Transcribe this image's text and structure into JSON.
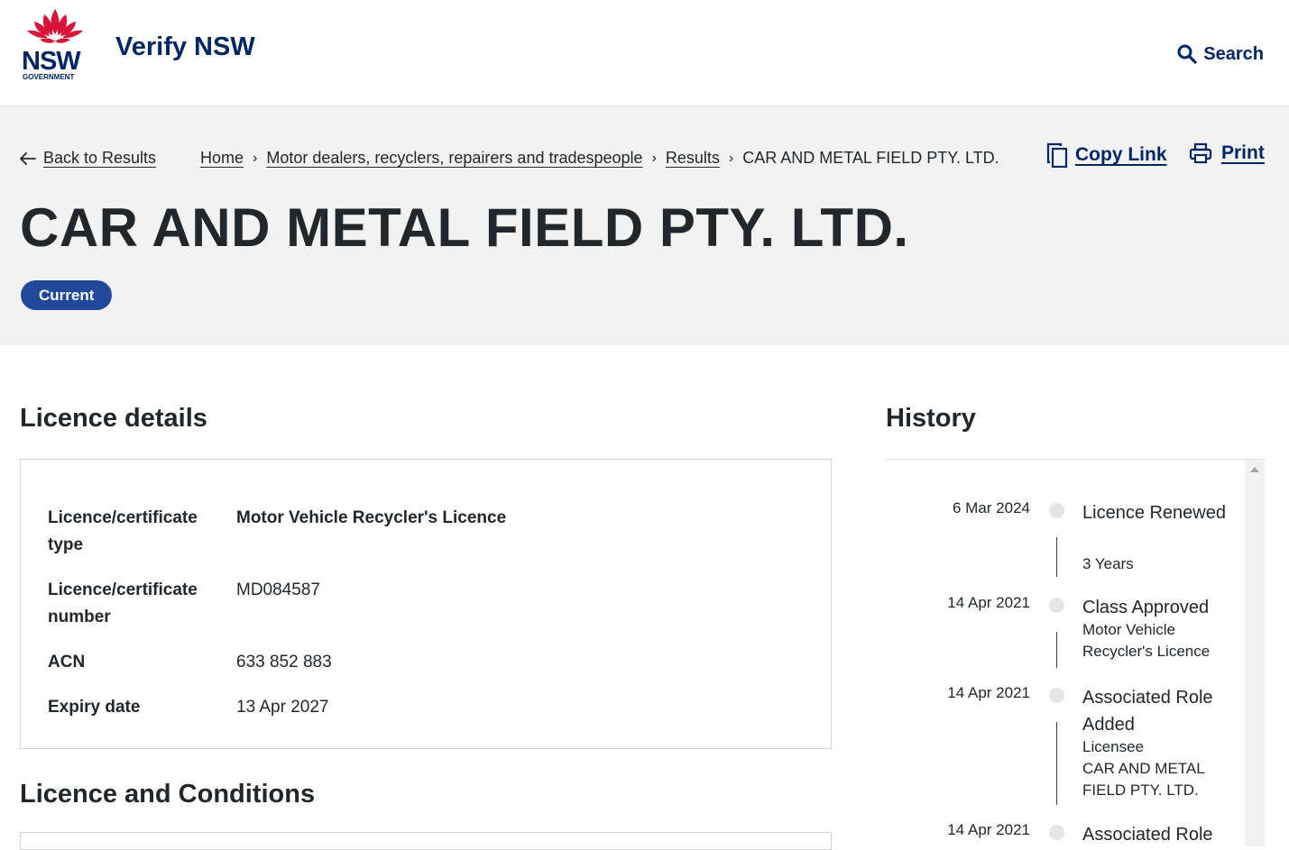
{
  "header": {
    "logo_text": "NSW",
    "logo_subtext": "GOVERNMENT",
    "site_title": "Verify NSW",
    "search_label": "Search",
    "brand_color": "#002664",
    "accent_color": "#d7153a"
  },
  "hero": {
    "back_label": "Back to Results",
    "breadcrumb": {
      "home": "Home",
      "category": "Motor dealers, recyclers, repairers and tradespeople",
      "results": "Results",
      "current": "CAR AND METAL FIELD PTY. LTD."
    },
    "copy_link_label": "Copy Link",
    "print_label": "Print",
    "title": "CAR AND METAL FIELD PTY. LTD.",
    "status": "Current",
    "status_color": "#22489a"
  },
  "licence_details": {
    "heading": "Licence details",
    "rows": [
      {
        "label": "Licence/certificate type",
        "value": "Motor Vehicle Recycler's Licence"
      },
      {
        "label": "Licence/certificate number",
        "value": "MD084587"
      },
      {
        "label": "ACN",
        "value": "633 852 883"
      },
      {
        "label": "Expiry date",
        "value": "13 Apr 2027"
      }
    ]
  },
  "conditions": {
    "heading": "Licence and Conditions"
  },
  "history": {
    "heading": "History",
    "items": [
      {
        "date": "6 Mar 2024",
        "title": "Licence Renewed",
        "lines": [
          "3 Years"
        ]
      },
      {
        "date": "14 Apr 2021",
        "title": "Class Approved",
        "lines": [
          "Motor Vehicle Recycler's Licence"
        ]
      },
      {
        "date": "14 Apr 2021",
        "title": "Associated Role Added",
        "lines": [
          "Licensee",
          "CAR AND METAL FIELD PTY. LTD."
        ]
      },
      {
        "date": "14 Apr 2021",
        "title": "Associated Role",
        "lines": []
      }
    ]
  }
}
